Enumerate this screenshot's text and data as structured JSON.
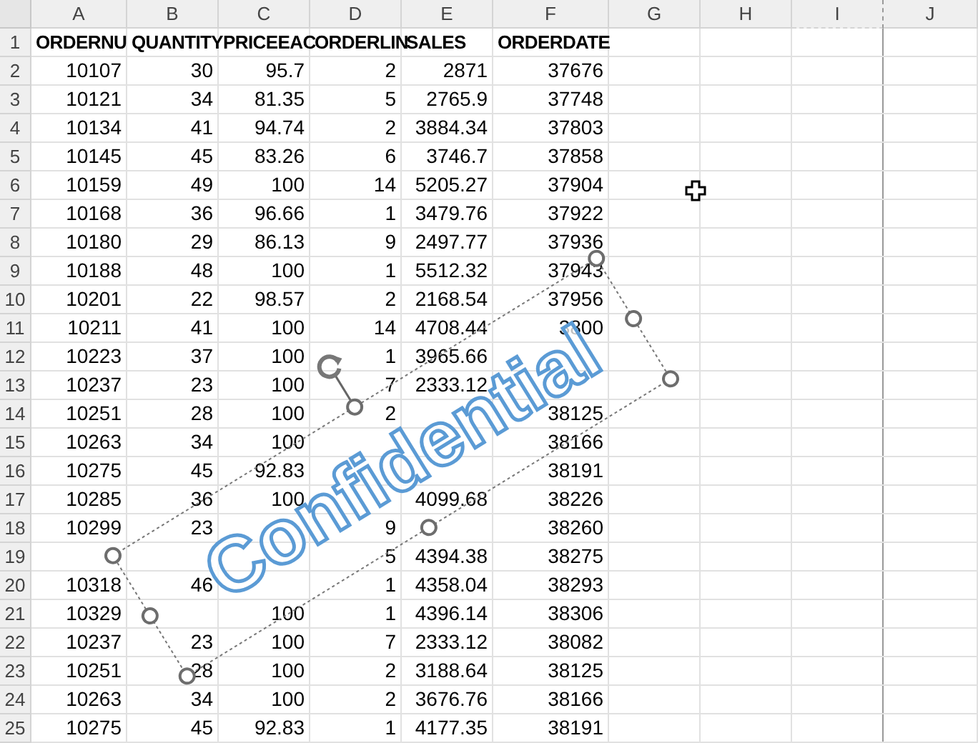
{
  "columns": [
    "A",
    "B",
    "C",
    "D",
    "E",
    "F",
    "G",
    "H",
    "I",
    "J"
  ],
  "rows": [
    {
      "number": "1",
      "kind": "header",
      "cells": [
        "ORDERNU",
        "QUANTITY",
        "PRICEEAC",
        "ORDERLIN",
        "SALES",
        "ORDERDATE"
      ]
    },
    {
      "number": "2",
      "kind": "data",
      "cells": [
        "10107",
        "30",
        "95.7",
        "2",
        "2871",
        "37676"
      ]
    },
    {
      "number": "3",
      "kind": "data",
      "cells": [
        "10121",
        "34",
        "81.35",
        "5",
        "2765.9",
        "37748"
      ]
    },
    {
      "number": "4",
      "kind": "data",
      "cells": [
        "10134",
        "41",
        "94.74",
        "2",
        "3884.34",
        "37803"
      ]
    },
    {
      "number": "5",
      "kind": "data",
      "cells": [
        "10145",
        "45",
        "83.26",
        "6",
        "3746.7",
        "37858"
      ]
    },
    {
      "number": "6",
      "kind": "data",
      "cells": [
        "10159",
        "49",
        "100",
        "14",
        "5205.27",
        "37904"
      ]
    },
    {
      "number": "7",
      "kind": "data",
      "cells": [
        "10168",
        "36",
        "96.66",
        "1",
        "3479.76",
        "37922"
      ]
    },
    {
      "number": "8",
      "kind": "data",
      "cells": [
        "10180",
        "29",
        "86.13",
        "9",
        "2497.77",
        "37936"
      ]
    },
    {
      "number": "9",
      "kind": "data",
      "cells": [
        "10188",
        "48",
        "100",
        "1",
        "5512.32",
        "37943"
      ]
    },
    {
      "number": "10",
      "kind": "data",
      "cells": [
        "10201",
        "22",
        "98.57",
        "2",
        "2168.54",
        "37956"
      ]
    },
    {
      "number": "11",
      "kind": "data",
      "cells": [
        "10211",
        "41",
        "100",
        "14",
        "4708.44",
        "3800"
      ]
    },
    {
      "number": "12",
      "kind": "data",
      "cells": [
        "10223",
        "37",
        "100",
        "1",
        "3965.66",
        null
      ]
    },
    {
      "number": "13",
      "kind": "data",
      "cells": [
        "10237",
        "23",
        "100",
        "7",
        "2333.12",
        null
      ]
    },
    {
      "number": "14",
      "kind": "data",
      "cells": [
        "10251",
        "28",
        "100",
        "2",
        null,
        "38125"
      ]
    },
    {
      "number": "15",
      "kind": "data",
      "cells": [
        "10263",
        "34",
        "100",
        null,
        null,
        "38166"
      ]
    },
    {
      "number": "16",
      "kind": "data",
      "cells": [
        "10275",
        "45",
        "92.83",
        null,
        null,
        "38191"
      ]
    },
    {
      "number": "17",
      "kind": "data",
      "cells": [
        "10285",
        "36",
        "100",
        null,
        "4099.68",
        "38226"
      ]
    },
    {
      "number": "18",
      "kind": "data",
      "cells": [
        "10299",
        "23",
        null,
        "9",
        null,
        "38260"
      ]
    },
    {
      "number": "19",
      "kind": "data",
      "cells": [
        null,
        null,
        null,
        "5",
        "4394.38",
        "38275"
      ]
    },
    {
      "number": "20",
      "kind": "data",
      "cells": [
        "10318",
        "46",
        null,
        "1",
        "4358.04",
        "38293"
      ]
    },
    {
      "number": "21",
      "kind": "data",
      "cells": [
        "10329",
        null,
        "100",
        "1",
        "4396.14",
        "38306"
      ]
    },
    {
      "number": "22",
      "kind": "data",
      "cells": [
        "10237",
        "23",
        "100",
        "7",
        "2333.12",
        "38082"
      ]
    },
    {
      "number": "23",
      "kind": "data",
      "cells": [
        "10251",
        "28",
        "100",
        "2",
        "3188.64",
        "38125"
      ]
    },
    {
      "number": "24",
      "kind": "data",
      "cells": [
        "10263",
        "34",
        "100",
        "2",
        "3676.76",
        "38166"
      ]
    },
    {
      "number": "25",
      "kind": "data",
      "cells": [
        "10275",
        "45",
        "92.83",
        "1",
        "4177.35",
        "38191"
      ]
    }
  ],
  "word_art": {
    "text": "Confidential",
    "selected": true
  }
}
